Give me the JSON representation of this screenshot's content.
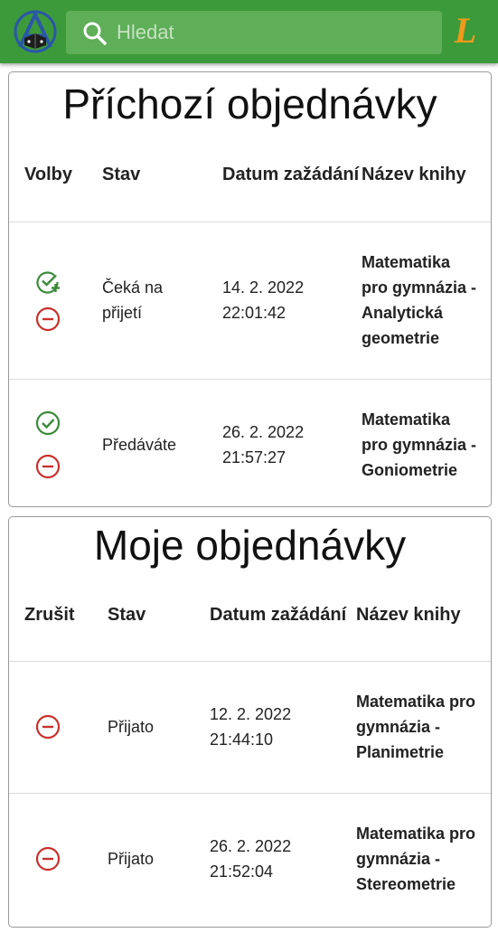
{
  "header": {
    "logo_icon": "school-logo-icon",
    "search": {
      "placeholder": "Hledat",
      "icon": "search-icon",
      "value": ""
    },
    "user_badge": "L",
    "colors": {
      "bar": "#3d9a3a",
      "search_bg": "#5fae58",
      "badge": "#f09a1c"
    }
  },
  "incoming": {
    "title": "Příchozí objednávky",
    "headers": {
      "actions": "Volby",
      "status": "Stav",
      "date": "Datum zažádání",
      "book": "Název knihy"
    },
    "rows": [
      {
        "actions": [
          "accept-add-icon",
          "cancel-icon"
        ],
        "status": "Čeká na přijetí",
        "date": "14. 2. 2022",
        "time": "22:01:42",
        "book": "Matematika pro gymnázia - Analytická geometrie"
      },
      {
        "actions": [
          "confirm-icon",
          "cancel-icon"
        ],
        "status": "Předáváte",
        "date": "26. 2. 2022",
        "time": "21:57:27",
        "book": "Matematika pro gymnázia - Goniometrie"
      }
    ]
  },
  "mine": {
    "title": "Moje objednávky",
    "headers": {
      "cancel": "Zrušit",
      "status": "Stav",
      "date": "Datum zažádání",
      "book": "Název knihy"
    },
    "rows": [
      {
        "actions": [
          "cancel-icon"
        ],
        "status": "Přijato",
        "date": "12. 2. 2022",
        "time": "21:44:10",
        "book": "Matematika pro gymnázia - Planimetrie"
      },
      {
        "actions": [
          "cancel-icon"
        ],
        "status": "Přijato",
        "date": "26. 2. 2022",
        "time": "21:52:04",
        "book": "Matematika pro gymnázia - Stereometrie"
      }
    ]
  },
  "colors": {
    "accept": "#3a8a3a",
    "cancel": "#c9302c"
  }
}
